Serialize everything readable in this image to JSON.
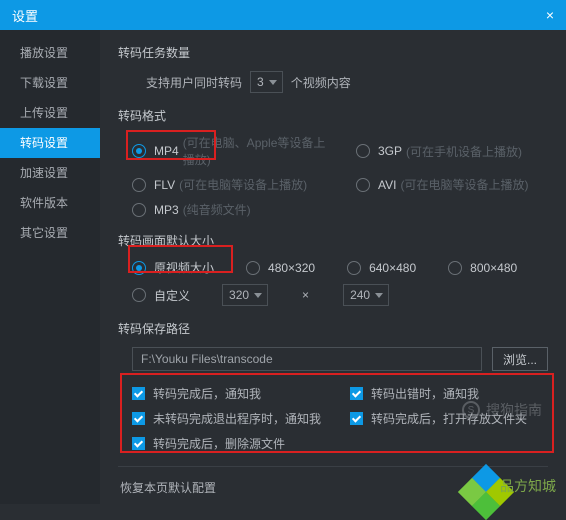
{
  "titlebar": {
    "title": "设置",
    "close": "×"
  },
  "sidebar": {
    "items": [
      {
        "label": "播放设置"
      },
      {
        "label": "下载设置"
      },
      {
        "label": "上传设置"
      },
      {
        "label": "转码设置"
      },
      {
        "label": "加速设置"
      },
      {
        "label": "软件版本"
      },
      {
        "label": "其它设置"
      }
    ]
  },
  "tasks": {
    "title": "转码任务数量",
    "prefix": "支持用户同时转码",
    "value": "3",
    "suffix": "个视频内容"
  },
  "format": {
    "title": "转码格式",
    "options": [
      {
        "name": "MP4",
        "desc": "(可在电脑、Apple等设备上播放)"
      },
      {
        "name": "3GP",
        "desc": "(可在手机设备上播放)"
      },
      {
        "name": "FLV",
        "desc": "(可在电脑等设备上播放)"
      },
      {
        "name": "AVI",
        "desc": "(可在电脑等设备上播放)"
      },
      {
        "name": "MP3",
        "desc": "(纯音频文件)"
      }
    ]
  },
  "size": {
    "title": "转码画面默认大小",
    "options": [
      "原视频大小",
      "480×320",
      "640×480",
      "800×480"
    ],
    "custom_label": "自定义",
    "w": "320",
    "mult": "×",
    "h": "240"
  },
  "path": {
    "title": "转码保存路径",
    "value": "F:\\Youku Files\\transcode",
    "browse": "浏览..."
  },
  "checks": {
    "items": [
      "转码完成后，通知我",
      "转码出错时，通知我",
      "未转码完成退出程序时，通知我",
      "转码完成后，打开存放文件夹",
      "转码完成后，删除源文件"
    ]
  },
  "footer": {
    "hint": "恢复本页默认配置"
  },
  "watermark": {
    "text": "搜狗指南"
  },
  "deco_text": "品方知城"
}
